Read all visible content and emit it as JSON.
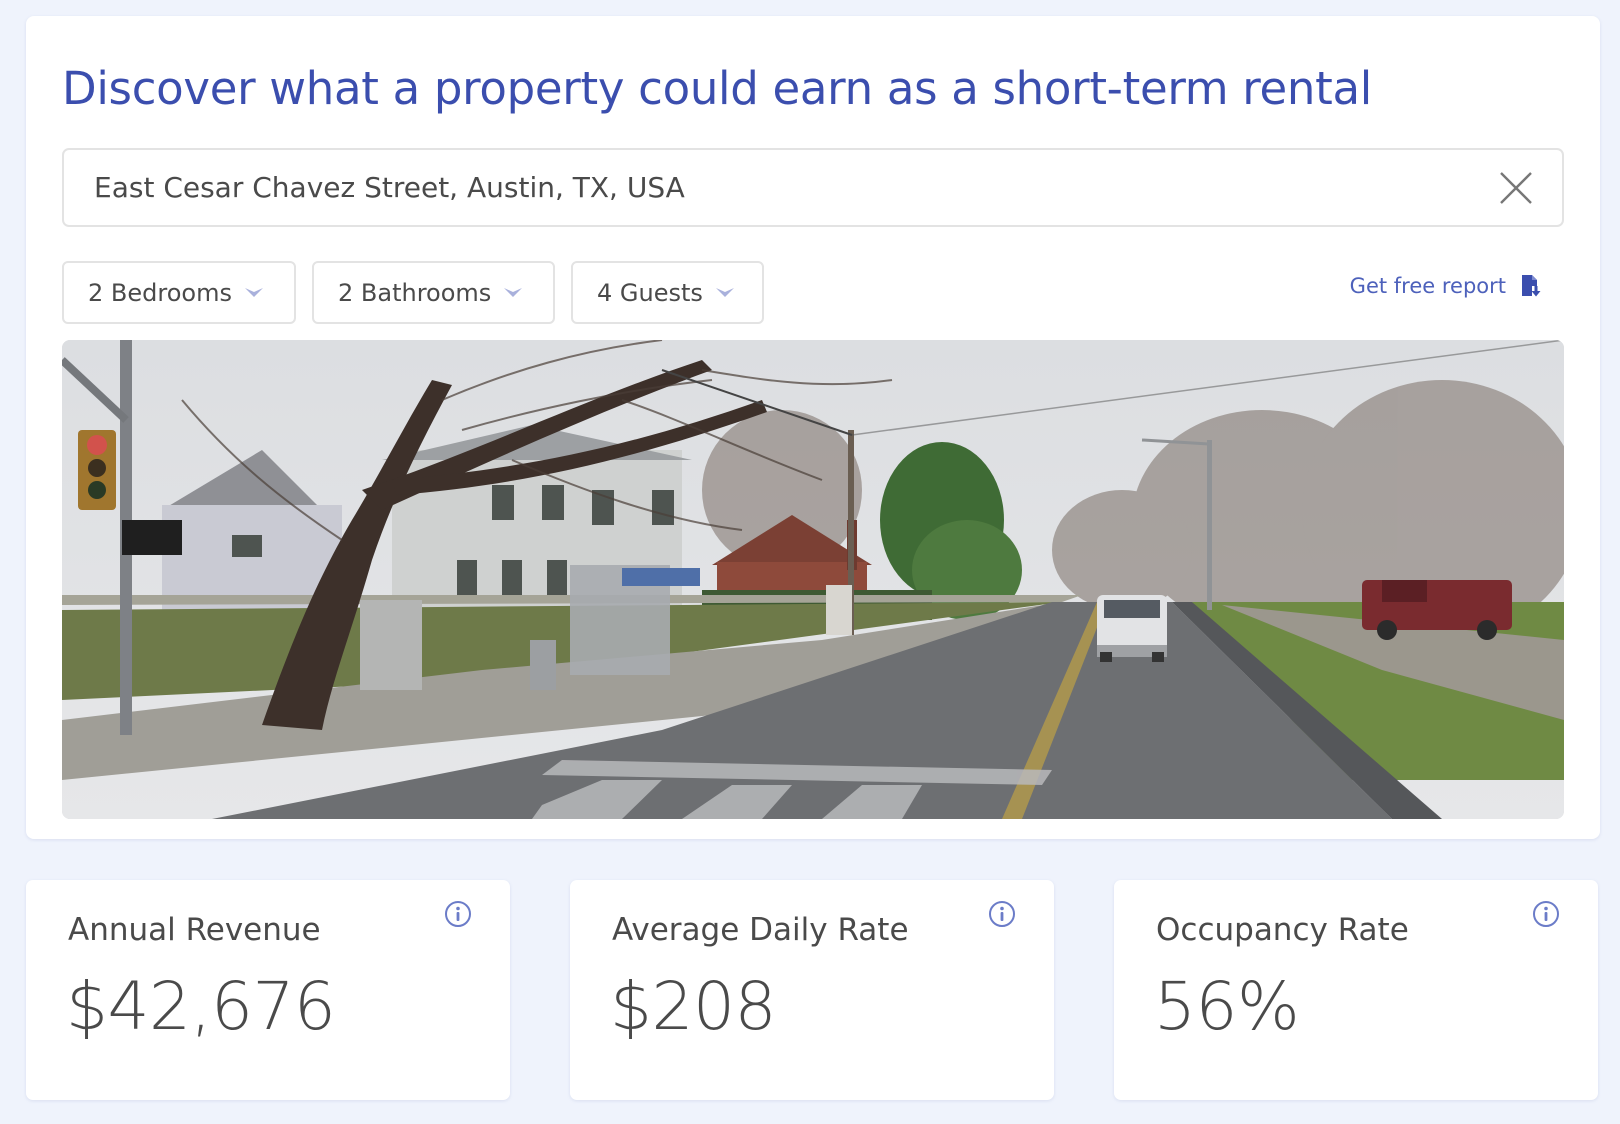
{
  "header": {
    "title": "Discover what a property could earn as a short-term rental"
  },
  "search": {
    "value": "East Cesar Chavez Street, Austin, TX, USA",
    "placeholder": "",
    "clear_icon": "close-icon"
  },
  "filters": [
    {
      "label": "2 Bedrooms",
      "icon": "chevron-down-icon"
    },
    {
      "label": "2 Bathrooms",
      "icon": "chevron-down-icon"
    },
    {
      "label": "4 Guests",
      "icon": "chevron-down-icon"
    }
  ],
  "report": {
    "label": "Get free report",
    "icon": "document-download-icon"
  },
  "photo": {
    "alt": "Street view of East Cesar Chavez Street, Austin, TX"
  },
  "stats": [
    {
      "label": "Annual Revenue",
      "value": "$42,676",
      "icon": "info-icon"
    },
    {
      "label": "Average Daily Rate",
      "value": "$208",
      "icon": "info-icon"
    },
    {
      "label": "Occupancy Rate",
      "value": "56%",
      "icon": "info-icon"
    }
  ],
  "colors": {
    "accent": "#3b4eae",
    "link": "#4d61bb",
    "chevron": "#a9b1dc",
    "info_icon": "#6b7cc8",
    "background": "#eff3fc",
    "text": "#4a4a4a"
  }
}
